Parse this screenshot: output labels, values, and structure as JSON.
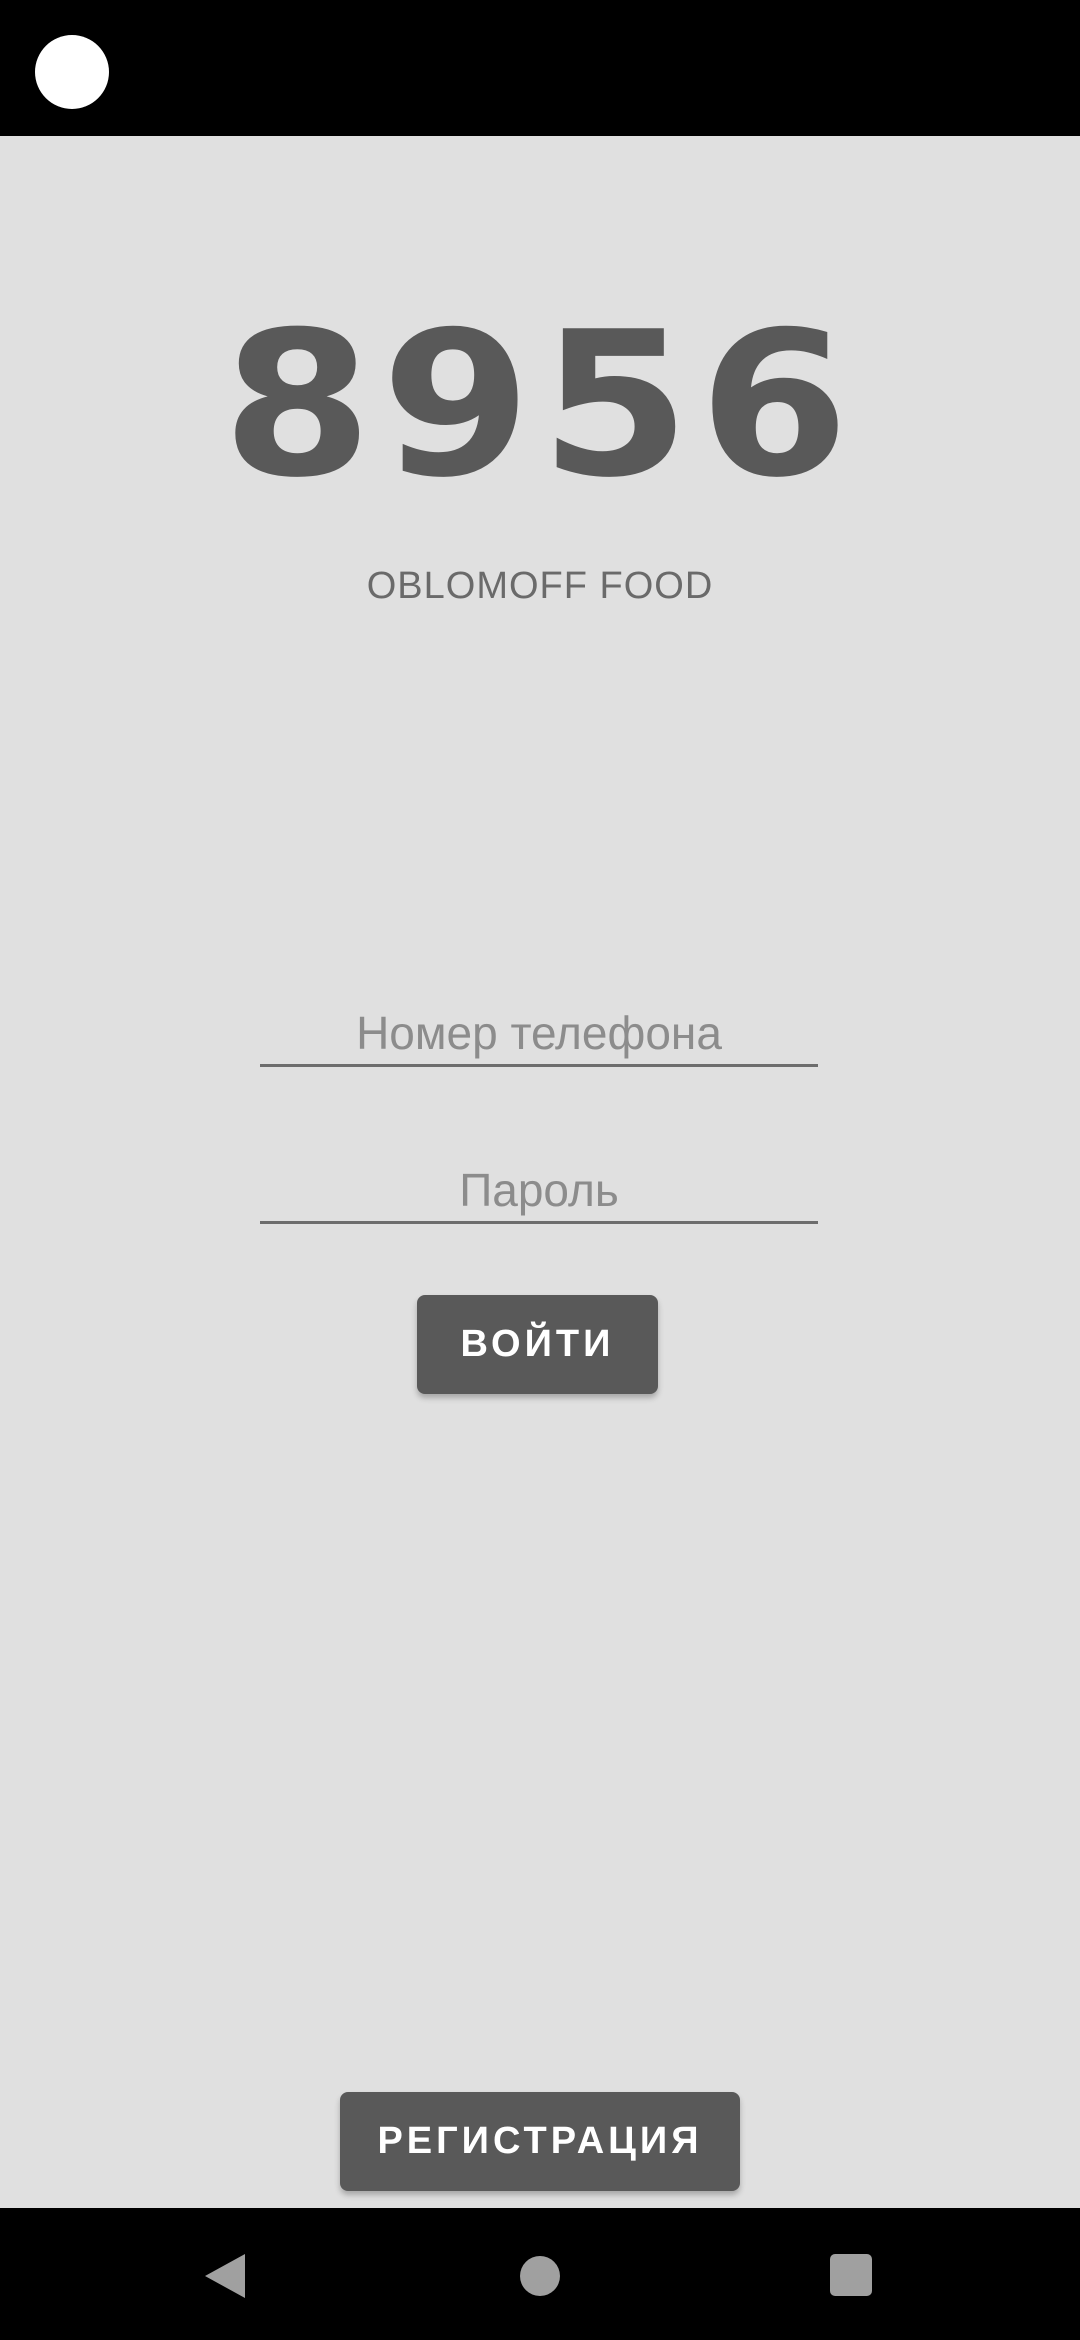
{
  "app": {
    "logo_text": "8956",
    "brand_name": "OBLOMOFF FOOD"
  },
  "login_form": {
    "phone_placeholder": "Номер телефона",
    "phone_value": "",
    "password_placeholder": "Пароль",
    "password_value": "",
    "login_label": "ВОЙТИ"
  },
  "footer": {
    "register_label": "РЕГИСТРАЦИЯ"
  },
  "navigation": {
    "back": "back-icon",
    "home": "home-icon",
    "recents": "recents-icon"
  },
  "colors": {
    "background": "#e0e0e0",
    "accent": "#595959"
  }
}
